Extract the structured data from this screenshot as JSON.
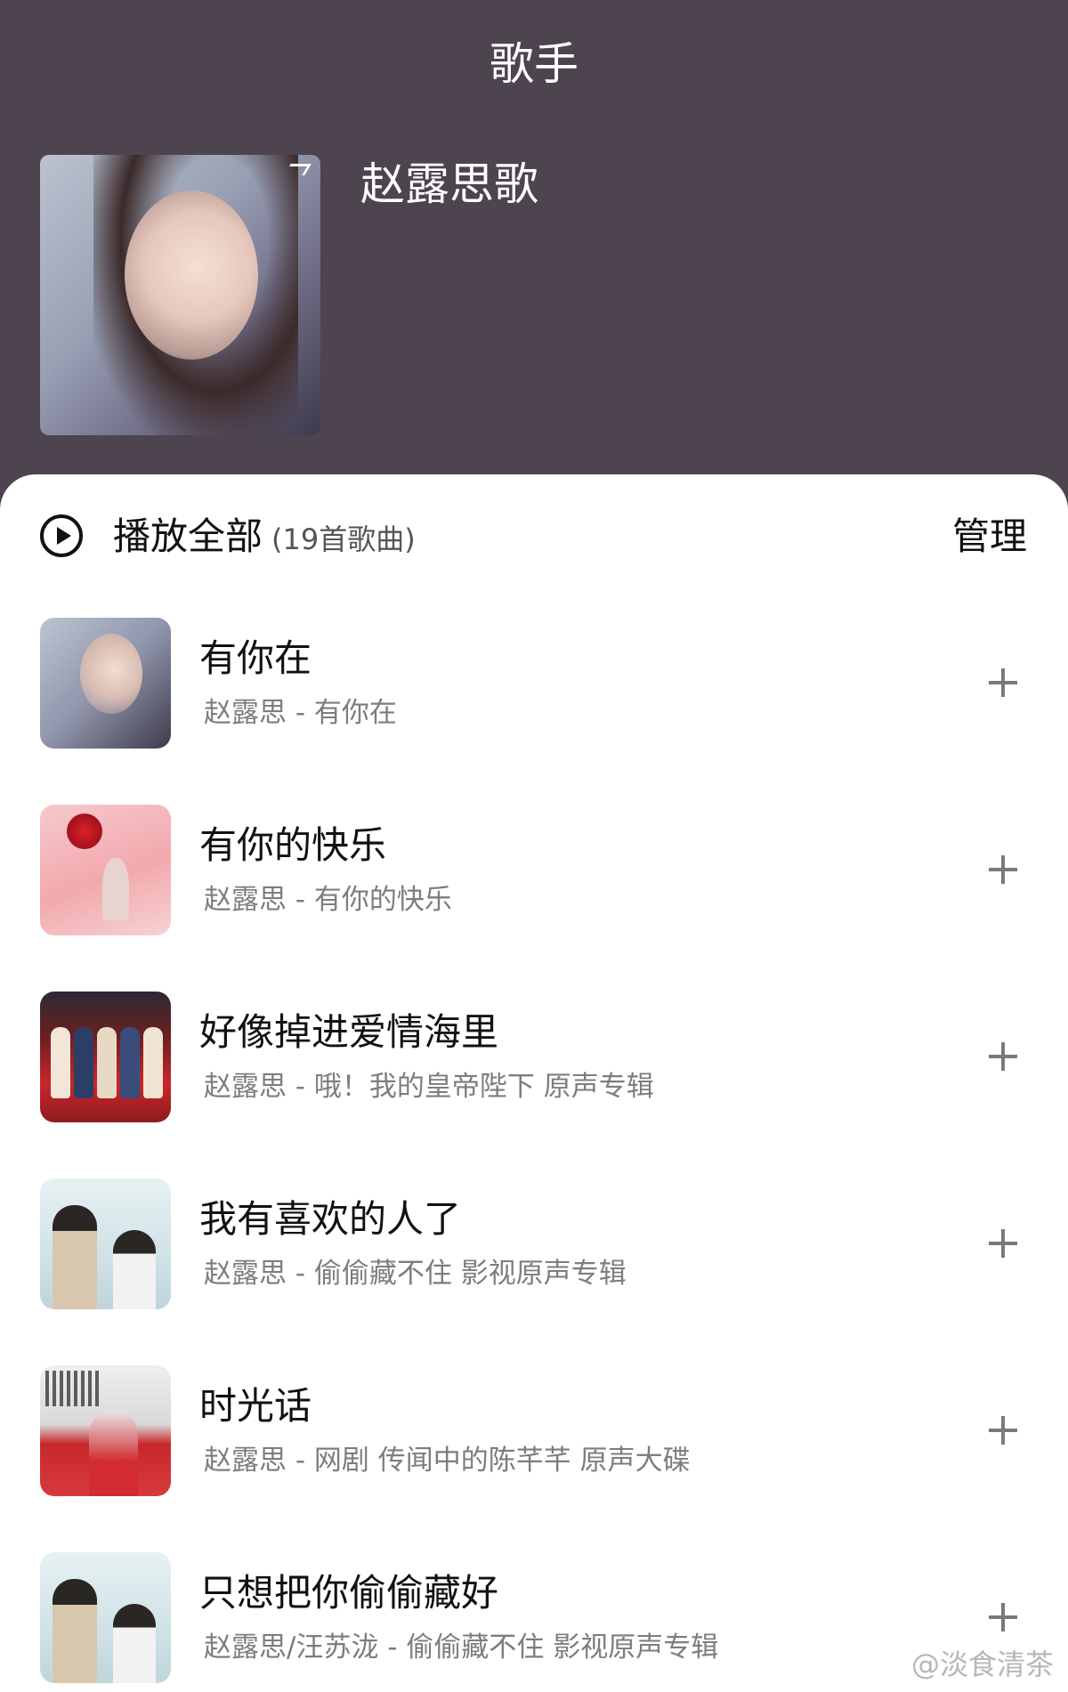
{
  "header": {
    "title": "歌手",
    "playlist_name": "赵露思歌"
  },
  "play_all": {
    "label": "播放全部",
    "count_text": "(19首歌曲)",
    "manage_label": "管理"
  },
  "songs": [
    {
      "title": "有你在",
      "subtitle": "赵露思 - 有你在"
    },
    {
      "title": "有你的快乐",
      "subtitle": "赵露思 - 有你的快乐"
    },
    {
      "title": "好像掉进爱情海里",
      "subtitle": "赵露思 - 哦！我的皇帝陛下 原声专辑"
    },
    {
      "title": "我有喜欢的人了",
      "subtitle": "赵露思 - 偷偷藏不住 影视原声专辑"
    },
    {
      "title": "时光话",
      "subtitle": "赵露思 - 网剧 传闻中的陈芊芊 原声大碟"
    },
    {
      "title": "只想把你偷偷藏好",
      "subtitle": "赵露思/汪苏泷 - 偷偷藏不住 影视原声专辑"
    }
  ],
  "watermark": "@淡食清茶",
  "colors": {
    "header_bg": "#4d4450",
    "sheet_bg": "#ffffff",
    "subtitle_text": "#7d7d7d"
  }
}
